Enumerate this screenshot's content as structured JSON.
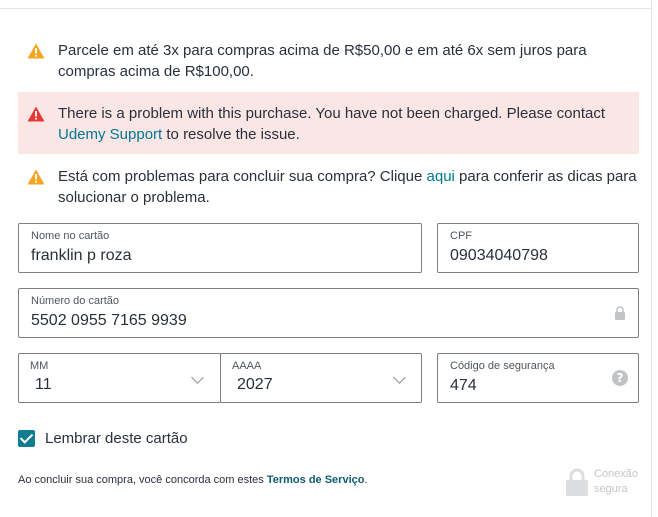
{
  "notices": {
    "installments": "Parcele em até 3x para compras acima de R$50,00 e em até 6x sem juros para compras acima de R$100,00.",
    "error_prefix": "There is a problem with this purchase. You have not been charged. Please contact ",
    "error_link": "Udemy Support",
    "error_suffix": " to resolve the issue.",
    "help_prefix": "Está com problemas para concluir sua compra? Clique ",
    "help_link": "aqui",
    "help_suffix": " para conferir as dicas para solucionar o problema."
  },
  "form": {
    "name_label": "Nome no cartão",
    "name_value": "franklin p roza",
    "cpf_label": "CPF",
    "cpf_value": "09034040798",
    "card_label": "Número do cartão",
    "card_value": "5502 0955 7165 9939",
    "month_label": "MM",
    "month_value": "11",
    "year_label": "AAAA",
    "year_value": "2027",
    "cvv_label": "Código de segurança",
    "cvv_value": "474",
    "help_glyph": "?"
  },
  "remember_label": "Lembrar deste cartão",
  "terms": {
    "prefix": "Ao concluir sua compra, você concorda com estes ",
    "link": "Termos de Serviço",
    "suffix": "."
  },
  "secure": {
    "line1": "Conexão",
    "line2": "segura"
  },
  "colors": {
    "warning": "#f4a623",
    "error": "#e53935",
    "link": "#007791",
    "checkbox": "#0f7c90",
    "error_bg": "#fbe6e6"
  },
  "icons": {
    "notice1": "warning-triangle-icon",
    "notice2": "error-triangle-icon",
    "notice3": "warning-triangle-icon",
    "card_lock": "lock-icon",
    "cvv_help": "question-circle-icon",
    "secure": "padlock-icon"
  }
}
